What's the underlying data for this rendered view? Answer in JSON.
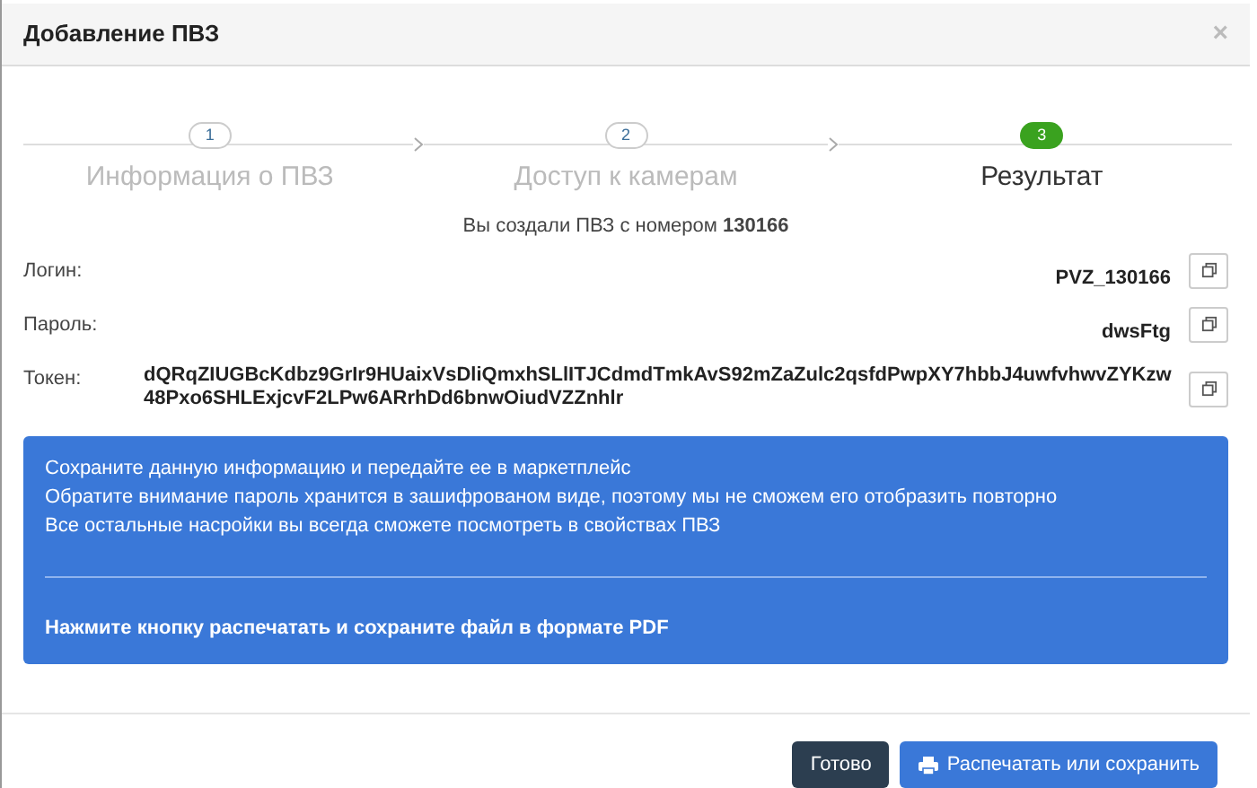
{
  "window": {
    "title": "Добавление ПВЗ",
    "close": "×"
  },
  "steps": [
    {
      "number": "1",
      "label": "Информация о ПВЗ",
      "active": false
    },
    {
      "number": "2",
      "label": "Доступ к камерам",
      "active": false
    },
    {
      "number": "3",
      "label": "Результат",
      "active": true
    }
  ],
  "result": "Вы создали ПВЗ с номером **130166**",
  "fields": [
    {
      "label": "Логин:",
      "value": "PVZ_130166"
    },
    {
      "label": "Пароль:",
      "value": "dwsFtg"
    },
    {
      "label": "Токен:",
      "value": "dQRqZIUGBcKdbz9GrIr9HUaixVsDliQmxhSLlITJCdmdTmkAvS92mZaZulc2qsfdPwpXY7hbbJ4uwfvhwvZYKzw48Pxo6SHLExjcvF2LPw6ARrhDd6bnwOiudVZZnhlr"
    }
  ],
  "alert": {
    "lines": [
      "Сохраните данную информацию и передайте ее в маркетплейс",
      "Обратите внимание пароль хранится в зашифрованом виде, поэтому мы не сможем его отобразить повторно",
      "Все остальные насройки вы всегда сможете посмотреть в свойствах ПВЗ"
    ],
    "footer": "Нажмите кнопку распечатать и сохраните файл в формате PDF"
  },
  "buttons": [
    {
      "label": "Готово",
      "kind": "dark"
    },
    {
      "label": "Распечатать или сохранить",
      "kind": "print"
    }
  ]
}
